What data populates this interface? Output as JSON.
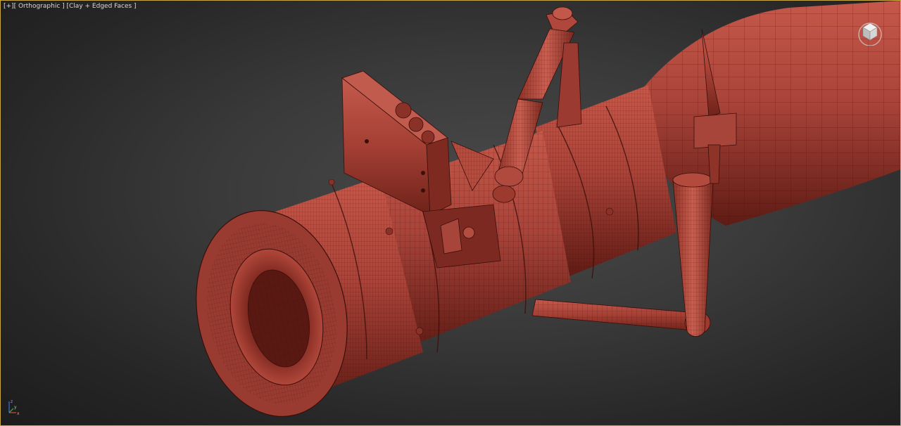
{
  "viewport": {
    "menu_plus": "[+]",
    "view_mode": "[ Orthographic ]",
    "shading_mode": "[Clay + Edged Faces ]"
  },
  "scene": {
    "object": "weapon-barrel-model",
    "material_color": "#b5483c",
    "wire_color": "#3a0e0a",
    "border_color": "#c8a640"
  },
  "viewcube": {
    "icon": "viewcube-icon"
  },
  "axis": {
    "x": "x",
    "y": "y",
    "z": "z"
  }
}
